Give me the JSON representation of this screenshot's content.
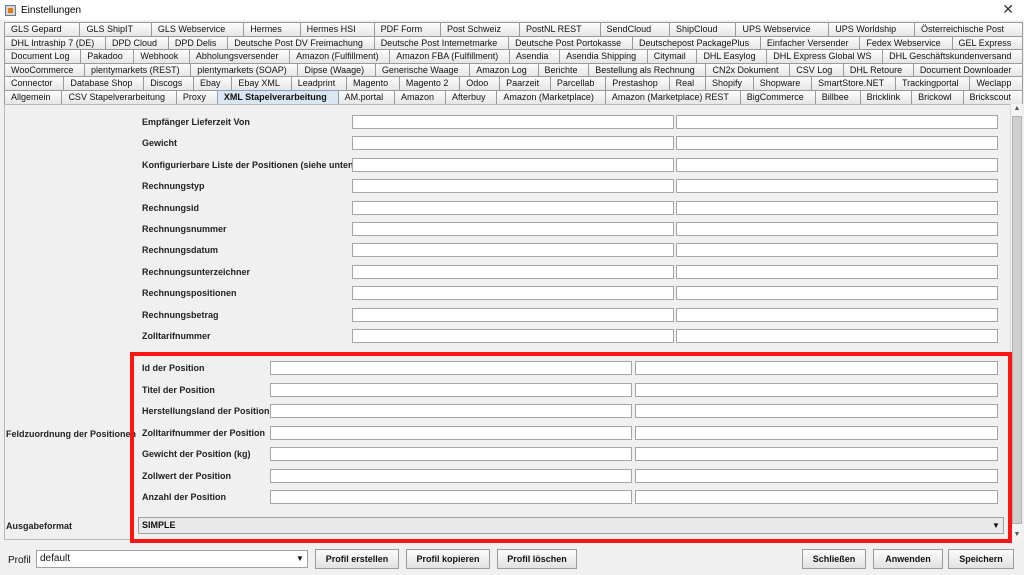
{
  "window": {
    "title": "Einstellungen",
    "close_glyph": "✕"
  },
  "tab_rows": [
    [
      "GLS Gepard",
      "GLS ShipIT",
      "GLS Webservice",
      "Hermes",
      "Hermes HSI",
      "PDF Form",
      "Post Schweiz",
      "PostNL REST",
      "SendCloud",
      "ShipCloud",
      "UPS Webservice",
      "UPS Worldship",
      "Österreichische Post"
    ],
    [
      "DHL Intraship 7 (DE)",
      "DPD Cloud",
      "DPD Delis",
      "Deutsche Post DV Freimachung",
      "Deutsche Post Internetmarke",
      "Deutsche Post Portokasse",
      "Deutschepost PackagePlus",
      "Einfacher Versender",
      "Fedex Webservice",
      "GEL Express"
    ],
    [
      "Document Log",
      "Pakadoo",
      "Webhook",
      "Abholungsversender",
      "Amazon (Fulfillment)",
      "Amazon FBA (Fulfillment)",
      "Asendia",
      "Asendia Shipping",
      "Citymail",
      "DHL Easylog",
      "DHL Express Global WS",
      "DHL Geschäftskundenversand"
    ],
    [
      "WooCommerce",
      "plentymarkets (REST)",
      "plentymarkets (SOAP)",
      "Dipse (Waage)",
      "Generische Waage",
      "Amazon Log",
      "Berichte",
      "Bestellung als Rechnung",
      "CN2x Dokument",
      "CSV Log",
      "DHL Retoure",
      "Document Downloader"
    ],
    [
      "Connector",
      "Database Shop",
      "Discogs",
      "Ebay",
      "Ebay XML",
      "Leadprint",
      "Magento",
      "Magento 2",
      "Odoo",
      "Paarzeit",
      "Parcellab",
      "Prestashop",
      "Real",
      "Shopify",
      "Shopware",
      "SmartStore.NET",
      "Trackingportal",
      "Weclapp"
    ],
    [
      "Allgemein",
      "CSV Stapelverarbeitung",
      "Proxy",
      "XML Stapelverarbeitung",
      "AM.portal",
      "Amazon",
      "Afterbuy",
      "Amazon (Marketplace)",
      "Amazon (Marketplace) REST",
      "BigCommerce",
      "Billbee",
      "Bricklink",
      "Brickowl",
      "Brickscout"
    ]
  ],
  "active_tab": "XML Stapelverarbeitung",
  "invoice_fields": [
    "Empfänger Lieferzeit Von",
    "Gewicht",
    "Konfigurierbare Liste der Positionen (siehe unten)",
    "Rechnungstyp",
    "Rechnungsid",
    "Rechnungsnummer",
    "Rechnungsdatum",
    "Rechnungsunterzeichner",
    "Rechnungspositionen",
    "Rechnungsbetrag",
    "Zolltarifnummer"
  ],
  "position_section_label": "Feldzuordnung der Positionen",
  "position_fields": [
    "Id der Position",
    "Titel der Position",
    "Herstellungsland der Position",
    "Zolltarifnummer der Position",
    "Gewicht der Position (kg)",
    "Zollwert der Position",
    "Anzahl der Position"
  ],
  "ausgabeformat": {
    "label": "Ausgabeformat",
    "value": "SIMPLE"
  },
  "bottom": {
    "profil_label": "Profil",
    "profil_value": "default",
    "buttons": {
      "profil_erstellen": "Profil erstellen",
      "profil_kopieren": "Profil kopieren",
      "profil_loeschen": "Profil löschen",
      "schliessen": "Schließen",
      "anwenden": "Anwenden",
      "speichern": "Speichern"
    }
  },
  "colors": {
    "highlight": "#ff1414",
    "active_tab": "#dbe6f3"
  }
}
